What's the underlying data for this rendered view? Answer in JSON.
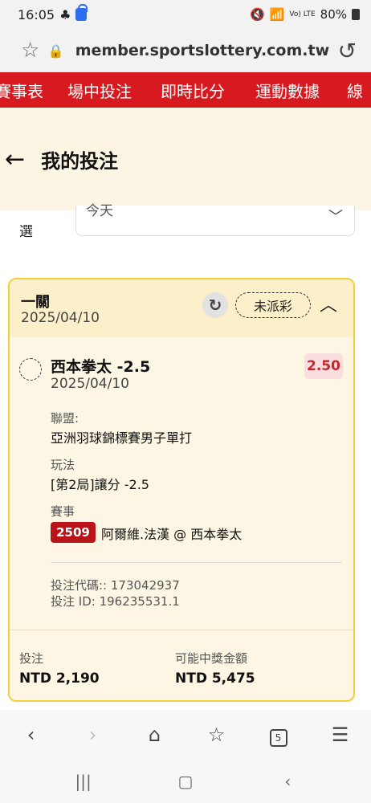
{
  "status_bar": {
    "time": "16:05",
    "signal": "Vo) LTE",
    "battery": "80%"
  },
  "browser": {
    "url": "member.sportslottery.com.tw"
  },
  "nav": {
    "items": [
      "賽事表",
      "場中投注",
      "即時比分",
      "運動數據",
      "線"
    ]
  },
  "header": {
    "back": "←",
    "title": "我的投注"
  },
  "filter": {
    "label": "選",
    "value": "今天"
  },
  "bet_card": {
    "type": "一關",
    "date": "2025/04/10",
    "status": "未派彩",
    "selection": {
      "name": "西本拳太 -2.5",
      "date": "2025/04/10",
      "odds": "2.50",
      "league_label": "聯盟:",
      "league": "亞洲羽球錦標賽男子單打",
      "market_label": "玩法",
      "market": "[第2局]讓分 -2.5",
      "event_label": "賽事",
      "event_no": "2509",
      "event_name": "阿爾維.法漢 @ 西本拳太"
    },
    "bet_code": "投注代碼:: 173042937",
    "bet_id": "投注 ID: 196235531.1",
    "stake_label": "投注",
    "stake": "NTD 2,190",
    "payout_label": "可能中獎金額",
    "payout": "NTD 5,475"
  },
  "browser_toolbar": {
    "tabs_count": "5"
  },
  "colors": {
    "brand_red": "#d71920",
    "header_bg": "#fdf5e3",
    "card_border": "#f3cf3a",
    "odds_red": "#c3272e"
  }
}
